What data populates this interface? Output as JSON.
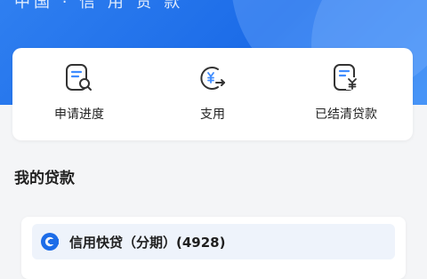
{
  "header": {
    "title": "中国 · 信 用 贷 款"
  },
  "quick_actions": [
    {
      "label": "申请进度",
      "icon": "application-progress-icon"
    },
    {
      "label": "支用",
      "icon": "drawdown-icon"
    },
    {
      "label": "已结清贷款",
      "icon": "settled-loan-icon"
    }
  ],
  "section": {
    "title": "我的贷款"
  },
  "loan": {
    "name": "信用快贷（分期）(4928)",
    "logo": "bank-logo-icon"
  },
  "colors": {
    "brand_blue": "#1c6ce8",
    "icon_blue": "#3f8cff",
    "icon_dark": "#333333"
  }
}
